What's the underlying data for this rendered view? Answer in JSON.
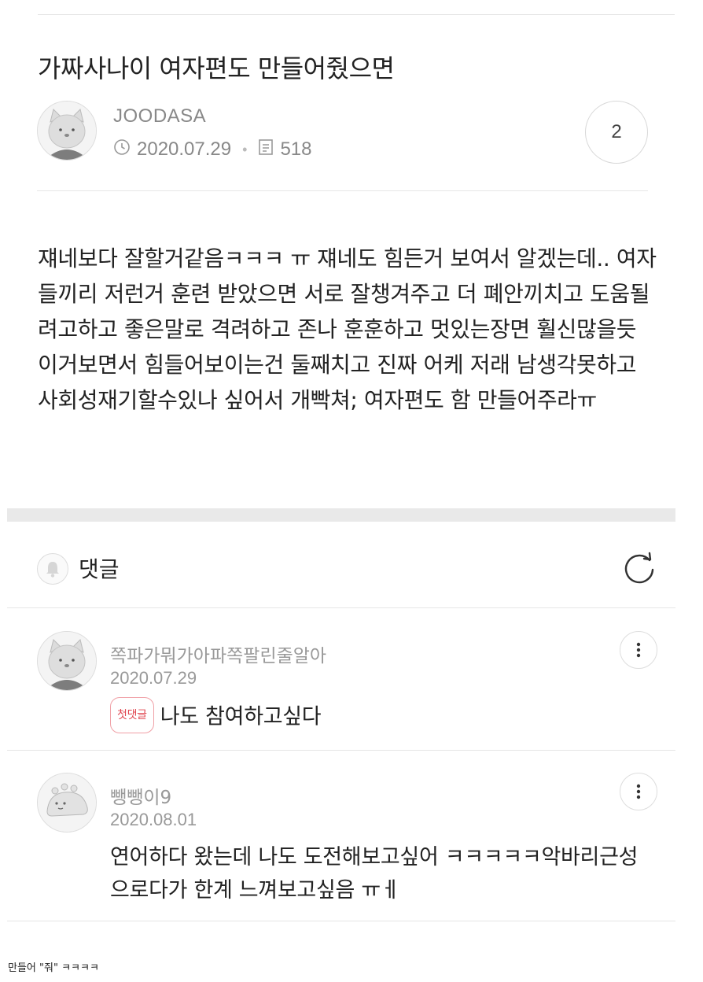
{
  "post": {
    "title": "가짜사나이 여자편도 만들어줬으면",
    "author": "JOODASA",
    "date": "2020.07.29",
    "views": "518",
    "comment_count": "2",
    "body": "쟤네보다 잘할거같음ㅋㅋㅋ ㅠ 쟤네도 힘든거 보여서 알겠는데.. 여자들끼리 저런거 훈련 받았으면 서로 잘챙겨주고 더 폐안끼치고 도움될려고하고 좋은말로 격려하고 존나 훈훈하고 멋있는장면 훨신많을듯 이거보면서 힘들어보이는건 둘째치고 진짜 어케 저래 남생각못하고 사회성재기할수있나 싶어서 개빡쳐; 여자편도 함 만들어주라ㅠ"
  },
  "comments_section": {
    "label": "댓글"
  },
  "comments": [
    {
      "name": "쪽파가뭐가아파쪽팔린줄알아",
      "date": "2020.07.29",
      "badge": "첫댓글",
      "text": "나도 참여하고싶다"
    },
    {
      "name": "뺑뺑이9",
      "date": "2020.08.01",
      "text": "연어하다 왔는데 나도 도전해보고싶어 ㅋㅋㅋㅋㅋ악바리근성으로다가 한계 느껴보고싶음 ㅠㅔ"
    }
  ],
  "caption": "만들어 \"줘\" ㅋㅋㅋㅋ",
  "icons": {
    "clock": "clock-icon",
    "views": "document-icon",
    "bell": "bell-icon",
    "refresh": "refresh-icon",
    "more": "more-vertical-icon"
  }
}
